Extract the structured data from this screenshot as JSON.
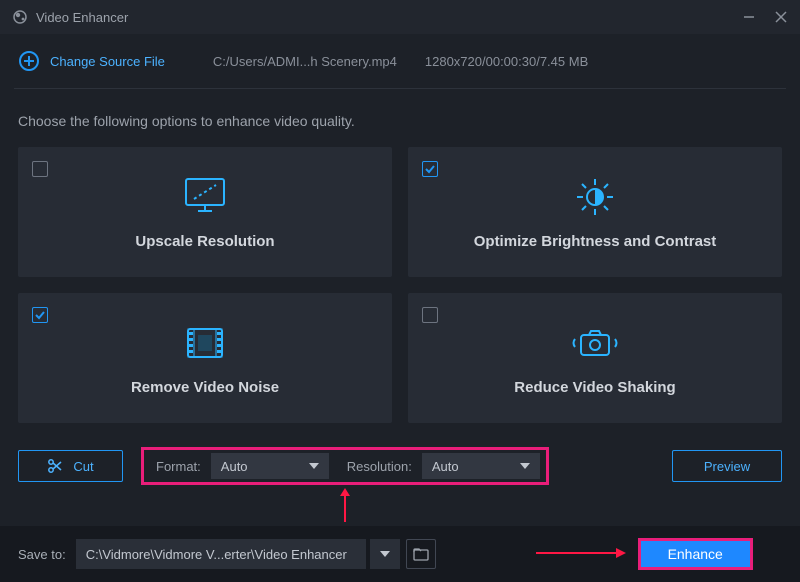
{
  "window": {
    "title": "Video Enhancer"
  },
  "toolbar": {
    "change_source": "Change Source File",
    "file_path": "C:/Users/ADMI...h Scenery.mp4",
    "file_meta": "1280x720/00:00:30/7.45 MB"
  },
  "instruction": "Choose the following options to enhance video quality.",
  "cards": {
    "upscale": {
      "label": "Upscale Resolution",
      "checked": false
    },
    "brightness": {
      "label": "Optimize Brightness and Contrast",
      "checked": true
    },
    "noise": {
      "label": "Remove Video Noise",
      "checked": true
    },
    "shake": {
      "label": "Reduce Video Shaking",
      "checked": false
    }
  },
  "controls": {
    "cut": "Cut",
    "format_label": "Format:",
    "format_value": "Auto",
    "resolution_label": "Resolution:",
    "resolution_value": "Auto",
    "preview": "Preview"
  },
  "bottom": {
    "save_label": "Save to:",
    "save_path": "C:\\Vidmore\\Vidmore V...erter\\Video Enhancer",
    "enhance": "Enhance"
  }
}
